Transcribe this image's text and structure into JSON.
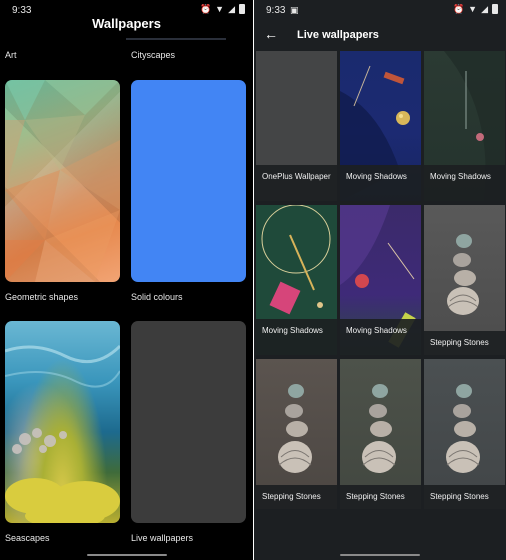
{
  "left_screen": {
    "status": {
      "time": "9:33"
    },
    "title": "Wallpapers",
    "categories": [
      {
        "label": "Art"
      },
      {
        "label": "Cityscapes"
      },
      {
        "label": "Geometric shapes"
      },
      {
        "label": "Solid colours"
      },
      {
        "label": "Seascapes"
      },
      {
        "label": "Live wallpapers"
      }
    ],
    "colors": {
      "solid_tile": "#4285f4",
      "background": "#000000"
    }
  },
  "right_screen": {
    "status": {
      "time": "9:33"
    },
    "title": "Live wallpapers",
    "back_icon": "arrow-left-icon",
    "wallpapers": [
      {
        "caption": "OnePlus Wallpaper"
      },
      {
        "caption": "Moving Shadows"
      },
      {
        "caption": "Moving Shadows"
      },
      {
        "caption": "Moving Shadows"
      },
      {
        "caption": "Moving Shadows"
      },
      {
        "caption": "Stepping Stones"
      },
      {
        "caption": "Stepping Stones"
      },
      {
        "caption": "Stepping Stones"
      },
      {
        "caption": "Stepping Stones"
      }
    ],
    "colors": {
      "background": "#1c1f22"
    }
  }
}
